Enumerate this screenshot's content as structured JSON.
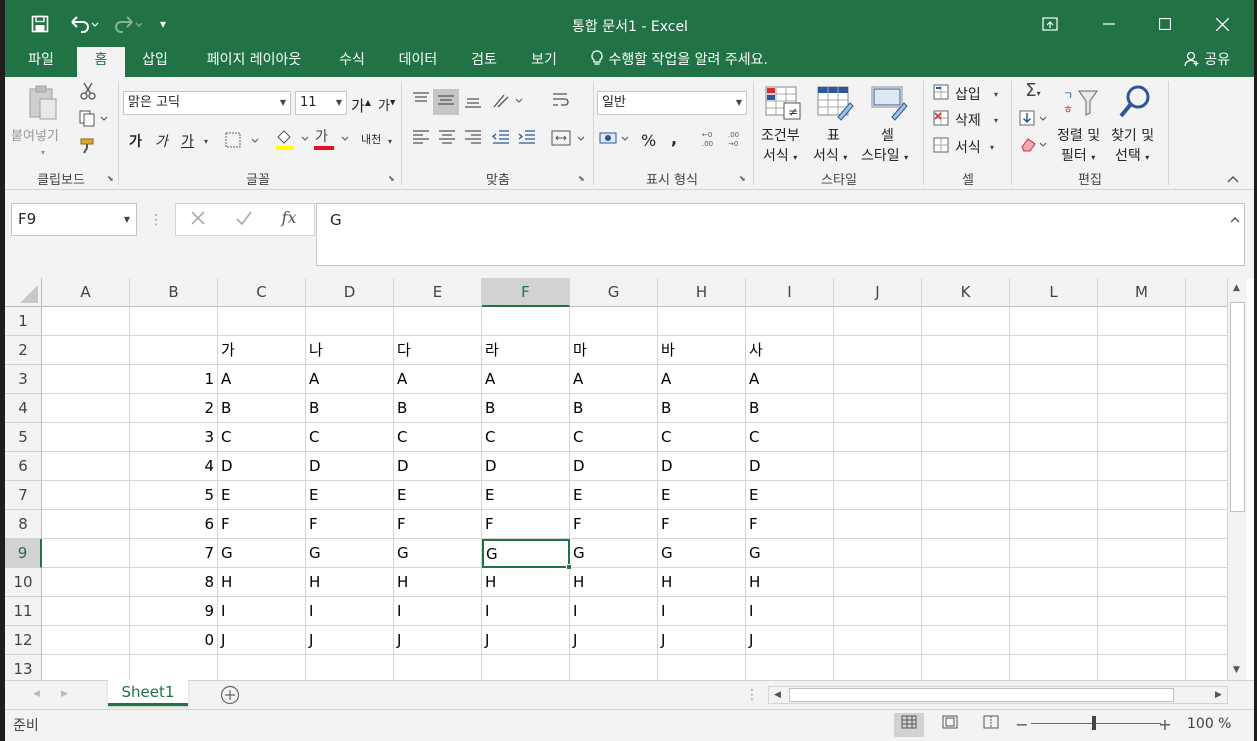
{
  "window": {
    "title": "통합 문서1 - Excel"
  },
  "quick_access": {
    "save_icon": "save-icon",
    "undo_icon": "undo-icon",
    "redo_icon": "redo-icon",
    "customize_icon": "customize-qat-icon"
  },
  "tabs": [
    "파일",
    "홈",
    "삽입",
    "페이지 레이아웃",
    "수식",
    "데이터",
    "검토",
    "보기"
  ],
  "active_tab": "홈",
  "tell_me": "수행할 작업을 알려 주세요.",
  "share": "공유",
  "ribbon": {
    "clipboard": {
      "label": "클립보드",
      "paste": "붙여넣기"
    },
    "font": {
      "label": "글꼴",
      "font_name": "맑은 고딕",
      "font_size": "11",
      "grow": "가",
      "shrink": "가",
      "bold": "가",
      "italic": "가",
      "underline": "가",
      "font_color_glyph": "가",
      "phonetic": "내천"
    },
    "alignment": {
      "label": "맞춤"
    },
    "number": {
      "label": "표시 형식",
      "format": "일반",
      "percent": "%",
      "comma": ","
    },
    "styles": {
      "label": "스타일",
      "conditional_line1": "조건부",
      "conditional_line2": "서식",
      "table_line1": "표",
      "table_line2": "서식",
      "cell_line1": "셀",
      "cell_line2": "스타일"
    },
    "cells": {
      "label": "셀",
      "insert": "삽입",
      "delete": "삭제",
      "format": "서식"
    },
    "editing": {
      "label": "편집",
      "sort_line1": "정렬 및",
      "sort_line2": "필터",
      "find_line1": "찾기 및",
      "find_line2": "선택"
    }
  },
  "formula_bar": {
    "name_box": "F9",
    "fx": "fx",
    "content": "G"
  },
  "columns": [
    "A",
    "B",
    "C",
    "D",
    "E",
    "F",
    "G",
    "H",
    "I",
    "J",
    "K",
    "L",
    "M"
  ],
  "selected_column": "F",
  "selected_row": "9",
  "selected_cell": "F9",
  "rows": [
    {
      "num": "1",
      "B": "",
      "C": "",
      "D": "",
      "E": "",
      "F": "",
      "G": "",
      "H": "",
      "I": ""
    },
    {
      "num": "2",
      "B": "",
      "C": "가",
      "D": "나",
      "E": "다",
      "F": "라",
      "G": "마",
      "H": "바",
      "I": "사"
    },
    {
      "num": "3",
      "B": "1",
      "C": "A",
      "D": "A",
      "E": "A",
      "F": "A",
      "G": "A",
      "H": "A",
      "I": "A"
    },
    {
      "num": "4",
      "B": "2",
      "C": "B",
      "D": "B",
      "E": "B",
      "F": "B",
      "G": "B",
      "H": "B",
      "I": "B"
    },
    {
      "num": "5",
      "B": "3",
      "C": "C",
      "D": "C",
      "E": "C",
      "F": "C",
      "G": "C",
      "H": "C",
      "I": "C"
    },
    {
      "num": "6",
      "B": "4",
      "C": "D",
      "D": "D",
      "E": "D",
      "F": "D",
      "G": "D",
      "H": "D",
      "I": "D"
    },
    {
      "num": "7",
      "B": "5",
      "C": "E",
      "D": "E",
      "E": "E",
      "F": "E",
      "G": "E",
      "H": "E",
      "I": "E"
    },
    {
      "num": "8",
      "B": "6",
      "C": "F",
      "D": "F",
      "E": "F",
      "F": "F",
      "G": "F",
      "H": "F",
      "I": "F"
    },
    {
      "num": "9",
      "B": "7",
      "C": "G",
      "D": "G",
      "E": "G",
      "F": "G",
      "G": "G",
      "H": "G",
      "I": "G"
    },
    {
      "num": "10",
      "B": "8",
      "C": "H",
      "D": "H",
      "E": "H",
      "F": "H",
      "G": "H",
      "H": "H",
      "I": "H"
    },
    {
      "num": "11",
      "B": "9",
      "C": "I",
      "D": "I",
      "E": "I",
      "F": "I",
      "G": "I",
      "H": "I",
      "I": "I"
    },
    {
      "num": "12",
      "B": "0",
      "C": "J",
      "D": "J",
      "E": "J",
      "F": "J",
      "G": "J",
      "H": "J",
      "I": "J"
    },
    {
      "num": "13",
      "B": "",
      "C": "",
      "D": "",
      "E": "",
      "F": "",
      "G": "",
      "H": "",
      "I": ""
    }
  ],
  "sheet_tab": "Sheet1",
  "status": {
    "ready": "준비",
    "zoom": "100 %"
  },
  "colors": {
    "accent": "#217346",
    "grid_line": "#d4d4d4",
    "header_bg": "#f3f3f3",
    "selected_header_bg": "#d2d2d2"
  }
}
